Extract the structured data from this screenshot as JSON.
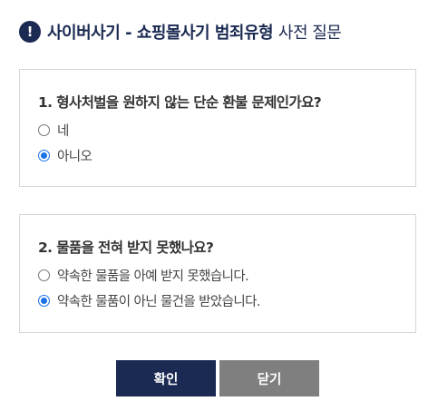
{
  "header": {
    "icon": "alert-icon",
    "icon_glyph": "!",
    "title_bold": "사이버사기 - 쇼핑몰사기 범죄유형",
    "title_normal": "사전 질문"
  },
  "questions": [
    {
      "title": "1. 형사처벌을 원하지 않는 단순 환불 문제인가요?",
      "options": [
        {
          "label": "네",
          "selected": false
        },
        {
          "label": "아니오",
          "selected": true
        }
      ]
    },
    {
      "title": "2. 물품을 전혀 받지 못했나요?",
      "options": [
        {
          "label": "약속한 물품을 아예 받지 못했습니다.",
          "selected": false
        },
        {
          "label": "약속한 물품이 아닌 물건을 받았습니다.",
          "selected": true
        }
      ]
    }
  ],
  "buttons": {
    "confirm_label": "확인",
    "close_label": "닫기"
  },
  "colors": {
    "primary": "#1b2a52",
    "secondary_button": "#7f7f7f",
    "radio_selected": "#1a73e8"
  }
}
